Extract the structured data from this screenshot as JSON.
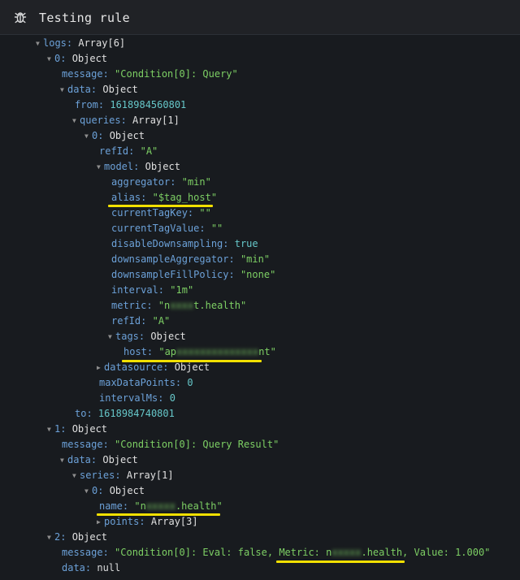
{
  "header": {
    "title": "Testing rule",
    "icon": "bug-icon"
  },
  "colors": {
    "background": "#181b1f",
    "key": "#6ca1d8",
    "string": "#7dcf64",
    "number": "#66c7c9",
    "highlight": "#f2e000"
  },
  "tree": {
    "logs": {
      "key": "logs:",
      "type": "Array[6]"
    },
    "log0": {
      "key": "0:",
      "type": "Object"
    },
    "log0_message": {
      "key": "message:",
      "value": "\"Condition[0]: Query\""
    },
    "log0_data": {
      "key": "data:",
      "type": "Object"
    },
    "log0_from": {
      "key": "from:",
      "value": "1618984560801"
    },
    "log0_queries": {
      "key": "queries:",
      "type": "Array[1]"
    },
    "q0": {
      "key": "0:",
      "type": "Object"
    },
    "q0_refId": {
      "key": "refId:",
      "value": "\"A\""
    },
    "q0_model": {
      "key": "model:",
      "type": "Object"
    },
    "m_aggregator": {
      "key": "aggregator:",
      "value": "\"min\""
    },
    "m_alias": {
      "key": "alias:",
      "value": "\"$tag_host\""
    },
    "m_currentTagKey": {
      "key": "currentTagKey:",
      "value": "\"\""
    },
    "m_currentTagValue": {
      "key": "currentTagValue:",
      "value": "\"\""
    },
    "m_disableDownsampling": {
      "key": "disableDownsampling:",
      "value": "true"
    },
    "m_downsampleAggregator": {
      "key": "downsampleAggregator:",
      "value": "\"min\""
    },
    "m_downsampleFillPolicy": {
      "key": "downsampleFillPolicy:",
      "value": "\"none\""
    },
    "m_interval": {
      "key": "interval:",
      "value": "\"1m\""
    },
    "m_metric": {
      "key": "metric:",
      "prefix": "\"n",
      "blurred": "xxxx",
      "suffix": "t.health\""
    },
    "m_refId": {
      "key": "refId:",
      "value": "\"A\""
    },
    "m_tags": {
      "key": "tags:",
      "type": "Object"
    },
    "t_host": {
      "key": "host:",
      "prefix": "\"ap",
      "blurred": "xxxxxxxxxxxxxx",
      "suffix": "nt\""
    },
    "q0_datasource": {
      "key": "datasource:",
      "type": "Object"
    },
    "q0_maxDataPoints": {
      "key": "maxDataPoints:",
      "value": "0"
    },
    "q0_intervalMs": {
      "key": "intervalMs:",
      "value": "0"
    },
    "log0_to": {
      "key": "to:",
      "value": "1618984740801"
    },
    "log1": {
      "key": "1:",
      "type": "Object"
    },
    "log1_message": {
      "key": "message:",
      "value": "\"Condition[0]: Query Result\""
    },
    "log1_data": {
      "key": "data:",
      "type": "Object"
    },
    "log1_series": {
      "key": "series:",
      "type": "Array[1]"
    },
    "s0": {
      "key": "0:",
      "type": "Object"
    },
    "s0_name": {
      "key": "name:",
      "prefix": "\"n",
      "blurred": "xxxxx",
      "suffix": ".health\""
    },
    "s0_points": {
      "key": "points:",
      "type": "Array[3]"
    },
    "log2": {
      "key": "2:",
      "type": "Object"
    },
    "log2_message": {
      "key": "message:",
      "prefix": "\"Condition[0]: Eval: false, Metric: n",
      "blurred": "xxxxx",
      "suffix": ".health, Value: 1.000\""
    },
    "log2_data": {
      "key": "data:",
      "value": "null"
    }
  }
}
